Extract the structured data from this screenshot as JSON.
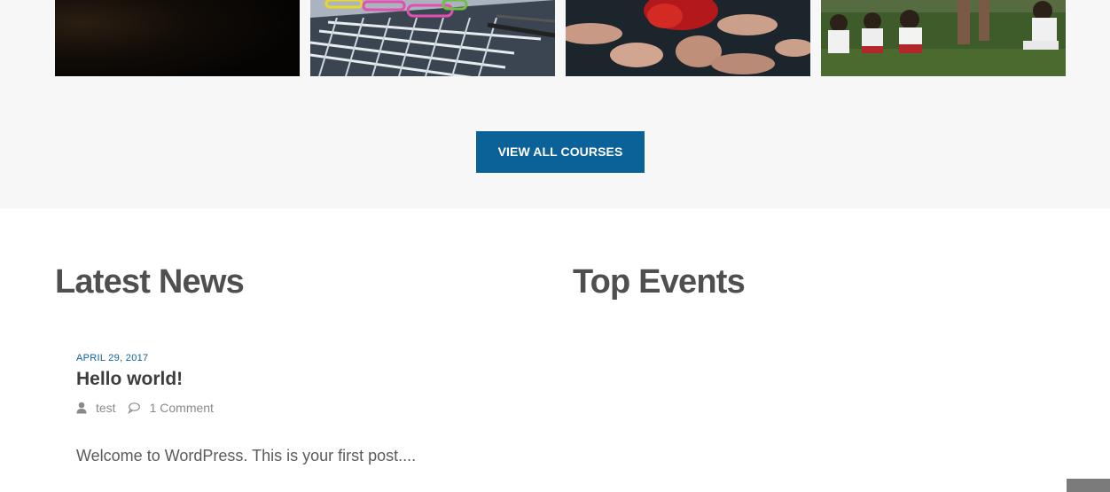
{
  "courses": {
    "thumbnails": [
      {
        "icon": "dark-texture-image"
      },
      {
        "icon": "paperclips-and-pen-image"
      },
      {
        "icon": "hands-holding-red-object-image"
      },
      {
        "icon": "children-on-grass-image"
      }
    ],
    "view_all_label": "VIEW ALL COURSES",
    "button_color": "#0b6299",
    "band_color": "#f7f7f7"
  },
  "news": {
    "heading": "Latest News",
    "post": {
      "date": "APRIL 29, 2017",
      "title": "Hello world!",
      "author_icon": "user-icon",
      "author": "test",
      "comments_icon": "comment-icon",
      "comments": "1 Comment",
      "excerpt": "Welcome to WordPress. This is your first post...."
    }
  },
  "events": {
    "heading": "Top Events"
  }
}
